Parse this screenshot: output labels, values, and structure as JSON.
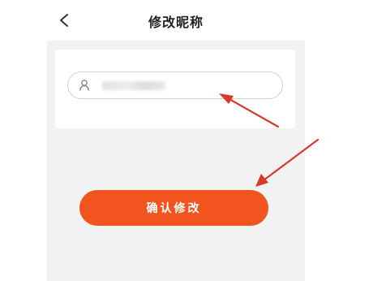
{
  "header": {
    "title": "修改昵称",
    "back_icon": "chevron-left-icon"
  },
  "form": {
    "user_icon": "user-icon",
    "nickname_value": ""
  },
  "confirm_button": {
    "label": "确认修改",
    "color": "#f2541f"
  },
  "annotation": {
    "arrow_color": "#d63a2a"
  }
}
